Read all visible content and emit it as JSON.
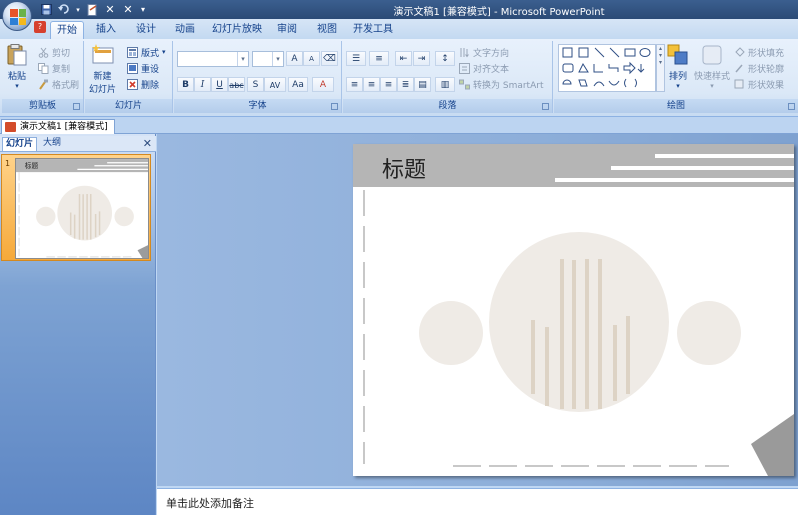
{
  "window": {
    "title": "演示文稿1 [兼容模式] - Microsoft PowerPoint"
  },
  "quick_access": {
    "save_icon": "save-icon",
    "undo_icon": "undo-icon",
    "redo_icon": "redo-icon",
    "customize_icon": "customize-qat-icon"
  },
  "tabs": [
    {
      "label": "开始",
      "active": true
    },
    {
      "label": "插入"
    },
    {
      "label": "设计"
    },
    {
      "label": "动画"
    },
    {
      "label": "幻灯片放映"
    },
    {
      "label": "审阅"
    },
    {
      "label": "视图"
    },
    {
      "label": "开发工具"
    }
  ],
  "ribbon": {
    "clipboard": {
      "label": "剪贴板",
      "paste": "粘贴",
      "cut": "剪切",
      "copy": "复制",
      "format_painter": "格式刷"
    },
    "slides": {
      "label": "幻灯片",
      "new_slide_line1": "新建",
      "new_slide_line2": "幻灯片",
      "layout": "版式",
      "reset": "重设",
      "delete": "删除"
    },
    "font": {
      "label": "字体",
      "bold": "B",
      "italic": "I",
      "underline": "U",
      "strike": "abc",
      "shadow": "S",
      "spacing": "AV",
      "case": "Aa",
      "grow": "A",
      "shrink": "A",
      "color": "A"
    },
    "paragraph": {
      "label": "段落",
      "text_direction": "文字方向",
      "align_text": "对齐文本",
      "convert_smartart": "转换为 SmartArt"
    },
    "drawing": {
      "label": "绘图",
      "arrange": "排列",
      "quick_styles": "快速样式",
      "shape_fill": "形状填充",
      "shape_outline": "形状轮廓",
      "shape_effects": "形状效果"
    }
  },
  "document_tab": "演示文稿1 [兼容模式]",
  "left_pane": {
    "tab_slides": "幻灯片",
    "tab_outline": "大纲",
    "close": "✕",
    "slide_number": "1",
    "thumb_title": "标题"
  },
  "slide": {
    "title": "标题"
  },
  "notes": {
    "placeholder": "单击此处添加备注"
  },
  "colors": {
    "header_gray": "#b5b5b5",
    "circle_fill": "#efebe6",
    "bar_color": "#ddd3c5",
    "dash_color": "#c8c8c8"
  }
}
